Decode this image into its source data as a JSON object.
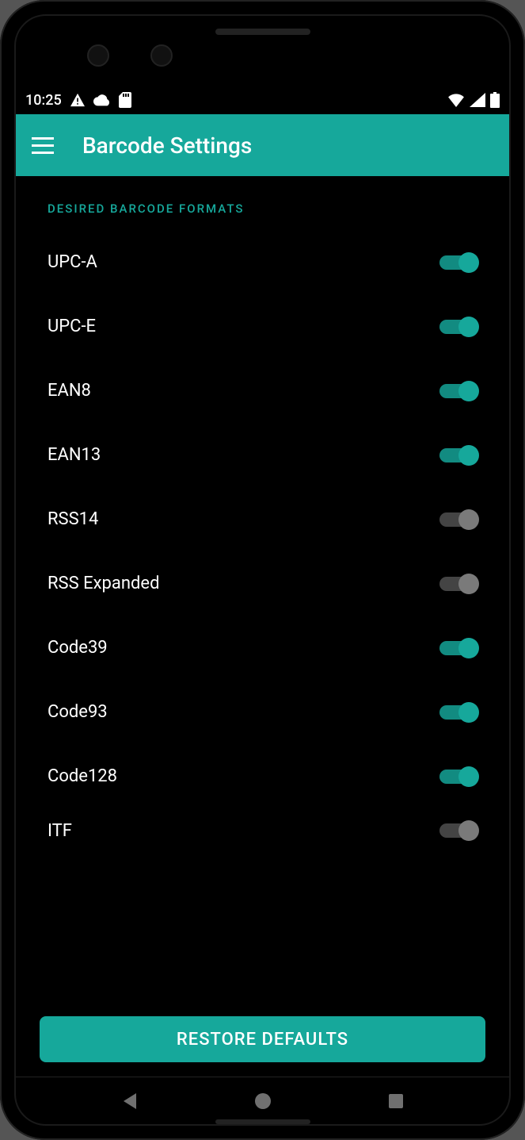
{
  "status": {
    "time": "10:25"
  },
  "appbar": {
    "title": "Barcode Settings"
  },
  "section_header": "DESIRED BARCODE FORMATS",
  "formats": [
    {
      "label": "UPC-A",
      "on": true
    },
    {
      "label": "UPC-E",
      "on": true
    },
    {
      "label": "EAN8",
      "on": true
    },
    {
      "label": "EAN13",
      "on": true
    },
    {
      "label": "RSS14",
      "on": false
    },
    {
      "label": "RSS Expanded",
      "on": false
    },
    {
      "label": "Code39",
      "on": true
    },
    {
      "label": "Code93",
      "on": true
    },
    {
      "label": "Code128",
      "on": true
    },
    {
      "label": "ITF",
      "on": false
    }
  ],
  "restore_button": "RESTORE DEFAULTS"
}
